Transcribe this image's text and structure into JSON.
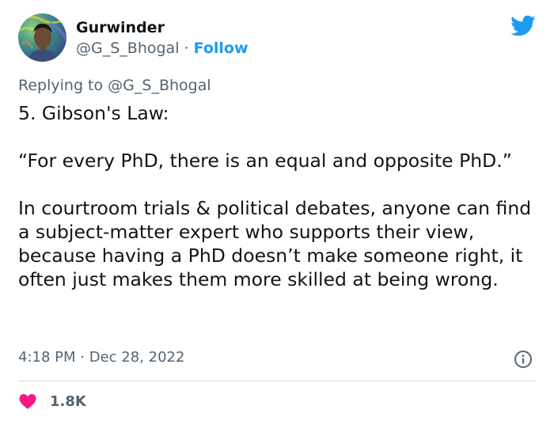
{
  "author": {
    "display_name": "Gurwinder",
    "handle": "@G_S_Bhogal",
    "separator": "·",
    "follow_label": "Follow"
  },
  "reply": {
    "prefix": "Replying to",
    "mention": "@G_S_Bhogal"
  },
  "tweet": {
    "paragraphs": [
      "5. Gibson's Law:",
      "“For every PhD, there is an equal and opposite PhD.”",
      "In courtroom trials & political debates, anyone can find a subject-matter expert who supports their view, because having a PhD doesn’t make someone right, it often just makes them more skilled at being wrong."
    ],
    "time": "4:18 PM",
    "date_separator": "·",
    "date": "Dec 28, 2022"
  },
  "engagement": {
    "likes": "1.8K"
  },
  "icons": {
    "brand": "twitter-bird-icon",
    "info": "info-icon",
    "like": "heart-icon"
  },
  "colors": {
    "brand_blue": "#1d9bf0",
    "heart_red": "#f91880",
    "secondary_text": "#536471",
    "primary_text": "#0f1419",
    "divider": "#cfd9de"
  }
}
